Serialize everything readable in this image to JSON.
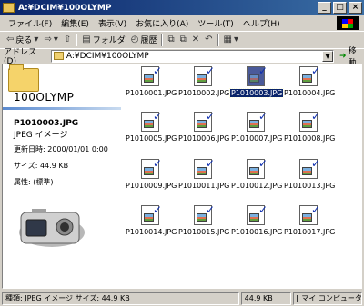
{
  "window": {
    "title": "A:¥DCIM¥100OLYMP"
  },
  "menu": [
    "ファイル(F)",
    "編集(E)",
    "表示(V)",
    "お気に入り(A)",
    "ツール(T)",
    "ヘルプ(H)"
  ],
  "toolbar": {
    "back": "戻る",
    "folders": "フォルダ",
    "history": "履歴"
  },
  "address": {
    "label": "アドレス(D)",
    "value": "A:¥DCIM¥100OLYMP",
    "go": "移動"
  },
  "details": {
    "folder_name": "100OLYMP",
    "file_name": "P1010003.JPG",
    "file_type": "JPEG イメージ",
    "modified": "更新日時: 2000/01/01 0:00",
    "size": "サイズ: 44.9 KB",
    "attributes": "属性: (標準)"
  },
  "files": [
    {
      "name": "P1010001.JPG",
      "selected": false
    },
    {
      "name": "P1010002.JPG",
      "selected": false
    },
    {
      "name": "P1010003.JPG",
      "selected": true
    },
    {
      "name": "P1010004.JPG",
      "selected": false
    },
    {
      "name": "P1010005.JPG",
      "selected": false
    },
    {
      "name": "P1010006.JPG",
      "selected": false
    },
    {
      "name": "P1010007.JPG",
      "selected": false
    },
    {
      "name": "P1010008.JPG",
      "selected": false
    },
    {
      "name": "P1010009.JPG",
      "selected": false
    },
    {
      "name": "P1010011.JPG",
      "selected": false
    },
    {
      "name": "P1010012.JPG",
      "selected": false
    },
    {
      "name": "P1010013.JPG",
      "selected": false
    },
    {
      "name": "P1010014.JPG",
      "selected": false
    },
    {
      "name": "P1010015.JPG",
      "selected": false
    },
    {
      "name": "P1010016.JPG",
      "selected": false
    },
    {
      "name": "P1010017.JPG",
      "selected": false
    }
  ],
  "status": {
    "info": "種類: JPEG イメージ サイズ: 44.9 KB",
    "size": "44.9 KB",
    "zone": "マイ コンピュータ"
  }
}
